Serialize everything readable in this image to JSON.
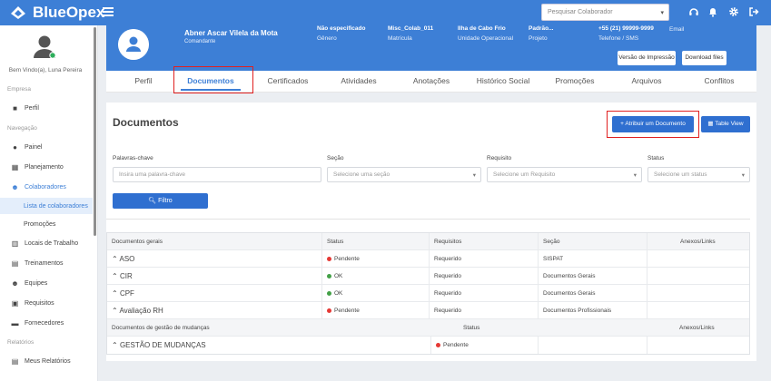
{
  "app": {
    "name": "BlueOpex",
    "brand_color": "#3d7fd6"
  },
  "header": {
    "search_placeholder": "Pesquisar Colaborador",
    "icons": [
      "headset-icon",
      "bell-icon",
      "gear-icon",
      "logout-icon"
    ]
  },
  "sidebar": {
    "welcome": "Bem Vindo(a), Luna Pereira",
    "sections": {
      "empresa": "Empresa",
      "navegacao": "Navegação",
      "relatorios": "Relatórios"
    },
    "items": {
      "perfil": "Perfil",
      "painel": "Painel",
      "planejamento": "Planejamento",
      "colaboradores": "Colaboradores",
      "lista": "Lista de colaboradores",
      "promocoes": "Promoções",
      "locais": "Locais de Trabalho",
      "treinamentos": "Treinamentos",
      "equipes": "Equipes",
      "requisitos": "Requisitos",
      "fornecedores": "Fornecedores",
      "meus_relatorios": "Meus Relatórios"
    }
  },
  "profile": {
    "name": "Abner Ascar Vilela da Mota",
    "role": "Comandante",
    "fields": [
      {
        "value": "Não especificado",
        "label": "Gênero"
      },
      {
        "value": "Misc_Colab_011",
        "label": "Matrícula"
      },
      {
        "value": "Ilha de Cabo Frio",
        "label": "Unidade Operacional"
      },
      {
        "value": "Padrão...",
        "label": "Projeto"
      },
      {
        "value": "+55 (21) 99999-9999",
        "label": "Telefone / SMS"
      },
      {
        "value": "",
        "label": "Email"
      }
    ],
    "print_button": "Versão de Impressão",
    "download_button": "Download files"
  },
  "tabs": [
    "Perfil",
    "Documentos",
    "Certificados",
    "Atividades",
    "Anotações",
    "Histórico Social",
    "Promoções",
    "Arquivos",
    "Conflitos"
  ],
  "documents": {
    "title": "Documentos",
    "add_button": "Atribuir um Documento",
    "table_view_button": "Table View",
    "filters": {
      "keywords_label": "Palavras-chave",
      "keywords_placeholder": "Insira uma palavra-chave",
      "section_label": "Seção",
      "section_placeholder": "Selecione uma seção",
      "requirement_label": "Requisito",
      "requirement_placeholder": "Selecione um Requisito",
      "status_label": "Status",
      "status_placeholder": "Selecione um status",
      "filter_button": "Filtro"
    },
    "general_table": {
      "headers": [
        "Documentos gerais",
        "Status",
        "Requisitos",
        "Seção",
        "Anexos/Links"
      ],
      "rows": [
        {
          "name": "ASO",
          "status": "Pendente",
          "status_color": "red",
          "requirement": "Requerido",
          "section": "SISPAT"
        },
        {
          "name": "CIR",
          "status": "OK",
          "status_color": "green",
          "requirement": "Requerido",
          "section": "Documentos Gerais"
        },
        {
          "name": "CPF",
          "status": "OK",
          "status_color": "green",
          "requirement": "Requerido",
          "section": "Documentos Gerais"
        },
        {
          "name": "Avaliação RH",
          "status": "Pendente",
          "status_color": "red",
          "requirement": "Requerido",
          "section": "Documentos Profissionais"
        }
      ]
    },
    "change_table": {
      "headers": [
        "Documentos de gestão de mudanças",
        "Status",
        "Anexos/Links"
      ],
      "rows": [
        {
          "name": "GESTÃO DE MUDANÇAS",
          "status": "Pendente",
          "status_color": "red"
        }
      ]
    }
  }
}
